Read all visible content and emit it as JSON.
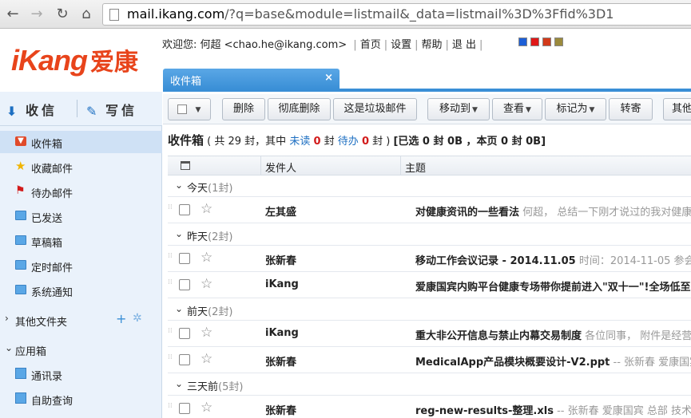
{
  "browser": {
    "url_host": "mail.ikang.com",
    "url_rest": "/?q=base&module=listmail&_data=listmail%3D%3Ffid%3D1"
  },
  "header": {
    "logo_en": "iKang",
    "logo_zh": "爱康",
    "welcome": "欢迎您: 何超 <chao.he@ikang.com>",
    "links": [
      "首页",
      "设置",
      "帮助",
      "退 出"
    ],
    "swatch_colors": [
      "#1d5fd6",
      "#e01818",
      "#d23a1a",
      "#9b8a3c"
    ]
  },
  "tab": {
    "label": "收件箱",
    "close": "×"
  },
  "sidebar": {
    "receive_label": "收信",
    "write_label": "写信",
    "folders": [
      {
        "label": "收件箱",
        "icon": "inbox-icon"
      },
      {
        "label": "收藏邮件",
        "icon": "star-icon"
      },
      {
        "label": "待办邮件",
        "icon": "flag-icon"
      },
      {
        "label": "已发送",
        "icon": "folder-icon"
      },
      {
        "label": "草稿箱",
        "icon": "folder-icon"
      },
      {
        "label": "定时邮件",
        "icon": "folder-icon"
      },
      {
        "label": "系统通知",
        "icon": "folder-icon"
      }
    ],
    "other_folders": "其他文件夹",
    "apps_title": "应用箱",
    "apps": [
      {
        "label": "通讯录"
      },
      {
        "label": "自助查询"
      }
    ]
  },
  "toolbar": {
    "delete": "删除",
    "delete_permanent": "彻底删除",
    "spam": "这是垃圾邮件",
    "move_to": "移动到",
    "view": "查看",
    "mark_as": "标记为",
    "forward": "转寄",
    "more": "其他"
  },
  "list": {
    "title": "收件箱",
    "summary_pre": "( 共 29 封，其中 ",
    "unread_label": "未读",
    "unread_count": "0",
    "summary_mid1": " 封 ",
    "todo_label": "待办",
    "todo_count": "0",
    "summary_mid2": " 封 ) ",
    "selection": "[已选 0 封 0B ，本页 0 封 0B]",
    "col_sender": "发件人",
    "col_subject": "主题"
  },
  "groups": [
    {
      "label": "今天",
      "count": "(1封)"
    },
    {
      "label": "昨天",
      "count": "(2封)"
    },
    {
      "label": "前天",
      "count": "(2封)"
    },
    {
      "label": "三天前",
      "count": "(5封)"
    }
  ],
  "mails": [
    {
      "sender": "左其盛",
      "subject": "对健康资讯的一些看法",
      "preview": " 何超， 总结一下刚才说过的我对健康"
    },
    {
      "sender": "张新春",
      "subject": "移动工作会议记录 - 2014.11.05",
      "preview": " 时间：2014-11-05 参会者"
    },
    {
      "sender": "iKang",
      "subject": "爱康国宾内购平台健康专场带你提前进入\"双十一\"!全场低至",
      "preview": ""
    },
    {
      "sender": "iKang",
      "subject": "重大非公开信息与禁止内幕交易制度",
      "preview": " 各位同事， 附件是经营"
    },
    {
      "sender": "张新春",
      "subject": "MedicalApp产品模块概要设计-V2.ppt",
      "preview": " -- 张新春 爱康国宾"
    },
    {
      "sender": "张新春",
      "subject": "reg-new-results-整理.xls",
      "preview": " -- 张新春 爱康国宾 总部 技术部"
    }
  ]
}
